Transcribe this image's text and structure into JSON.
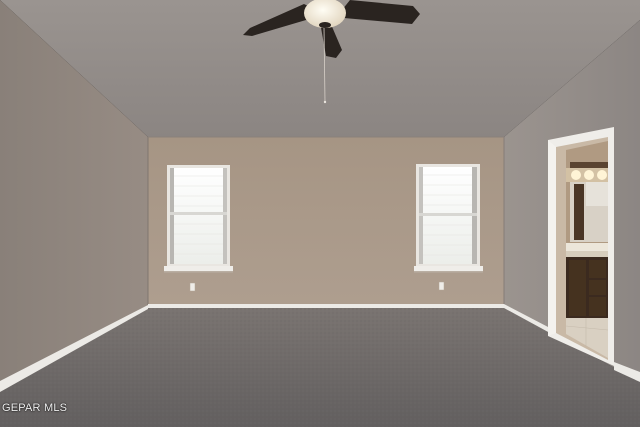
{
  "photo": {
    "subject": "empty-bedroom",
    "watermark": "GEPAR MLS",
    "colors": {
      "ceiling": "#918b87",
      "back_wall": "#ab9a8a",
      "left_wall": "#8e8580",
      "right_wall": "#938d89",
      "carpet": "#6e6a69",
      "trim": "#eceae6",
      "window_light": "#f4f5f2",
      "fan_blade": "#2a2420",
      "cabinet": "#3b2a1f"
    }
  }
}
